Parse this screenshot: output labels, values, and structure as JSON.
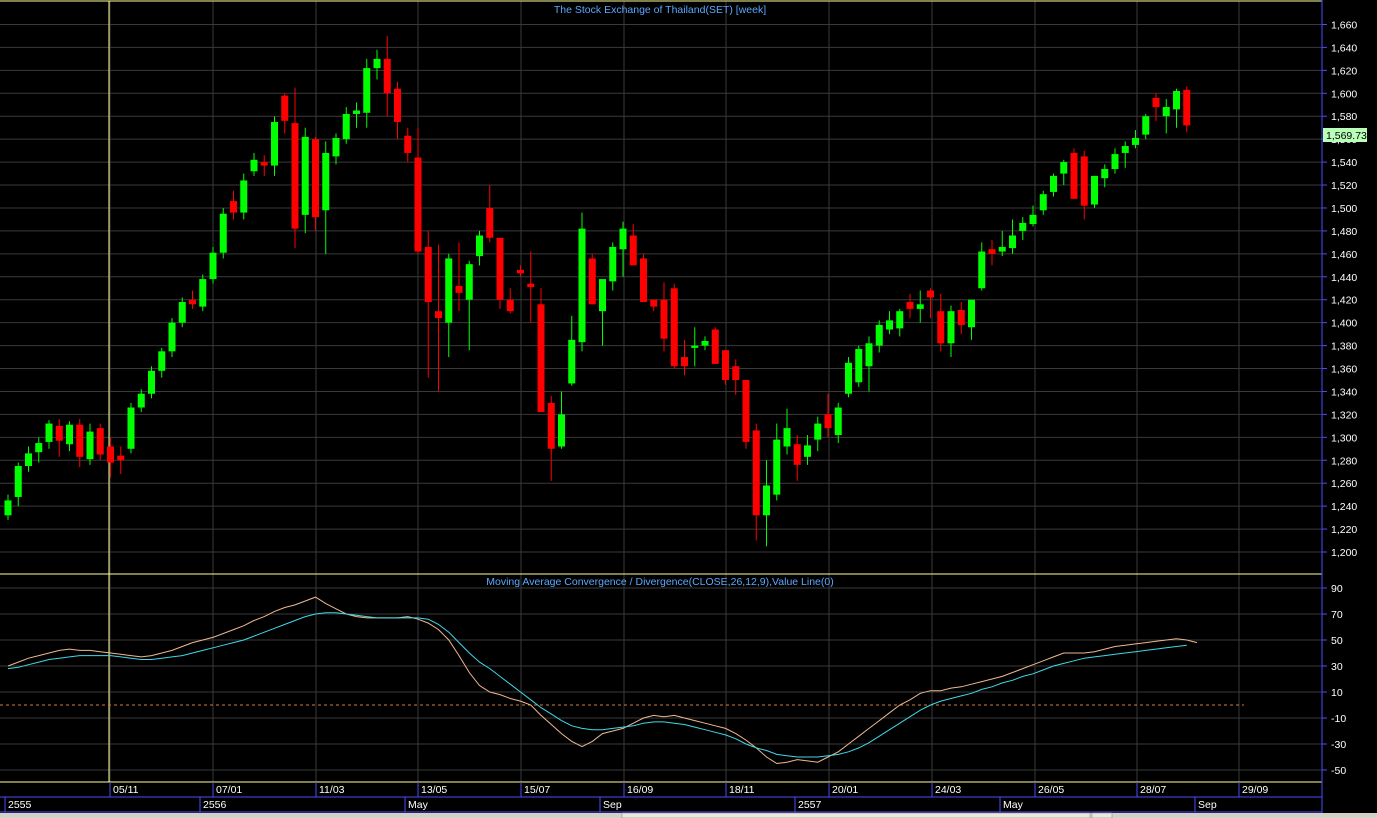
{
  "colors": {
    "background": "#000000",
    "grid": "#3a3a3a",
    "frame": "#ffff9a",
    "axis_frame": "#4b4bff",
    "title": "#5aa8ff",
    "up": "#00ff00",
    "down": "#ff0000",
    "macd_line": "#f0b890",
    "signal_line": "#40d8e8",
    "zero_line": "#d08040",
    "price_tag": "#b8ffb8"
  },
  "price_panel": {
    "title": "The Stock Exchange of Thailand(SET) [week]",
    "last_price_label": "1,569.73",
    "y_ticks": [
      "1,200",
      "1,220",
      "1,240",
      "1,260",
      "1,280",
      "1,300",
      "1,320",
      "1,340",
      "1,360",
      "1,380",
      "1,400",
      "1,420",
      "1,440",
      "1,460",
      "1,480",
      "1,500",
      "1,520",
      "1,540",
      "1,560",
      "1,580",
      "1,600",
      "1,620",
      "1,640",
      "1,660"
    ]
  },
  "macd_panel": {
    "title": "Moving Average Convergence / Divergence(CLOSE,26,12,9),Value Line(0)",
    "y_ticks": [
      "-50",
      "-30",
      "-10",
      "10",
      "30",
      "50",
      "70",
      "90"
    ]
  },
  "date_axis": {
    "upper": [
      "05/11",
      "07/01",
      "11/03",
      "13/05",
      "15/07",
      "16/09",
      "18/11",
      "20/01",
      "24/03",
      "26/05",
      "28/07",
      "29/09"
    ],
    "lower": [
      "2555",
      "2556",
      "May",
      "Sep",
      "2557",
      "May",
      "Sep"
    ]
  },
  "chart_data": [
    {
      "type": "candlestick",
      "title": "The Stock Exchange of Thailand(SET) [week]",
      "ylim": [
        1200,
        1660
      ],
      "candles": [
        [
          1232,
          1250,
          1228,
          1245
        ],
        [
          1248,
          1278,
          1240,
          1275
        ],
        [
          1275,
          1292,
          1270,
          1286
        ],
        [
          1287,
          1300,
          1278,
          1295
        ],
        [
          1296,
          1315,
          1290,
          1312
        ],
        [
          1310,
          1316,
          1283,
          1297
        ],
        [
          1294,
          1314,
          1288,
          1311
        ],
        [
          1311,
          1316,
          1274,
          1283
        ],
        [
          1281,
          1312,
          1276,
          1305
        ],
        [
          1308,
          1312,
          1280,
          1285
        ],
        [
          1292,
          1300,
          1265,
          1278
        ],
        [
          1284,
          1292,
          1268,
          1280
        ],
        [
          1290,
          1330,
          1286,
          1326
        ],
        [
          1326,
          1342,
          1322,
          1338
        ],
        [
          1338,
          1362,
          1334,
          1358
        ],
        [
          1358,
          1378,
          1352,
          1375
        ],
        [
          1375,
          1404,
          1370,
          1400
        ],
        [
          1400,
          1422,
          1396,
          1418
        ],
        [
          1420,
          1428,
          1412,
          1416
        ],
        [
          1414,
          1442,
          1410,
          1438
        ],
        [
          1438,
          1466,
          1434,
          1461
        ],
        [
          1461,
          1500,
          1456,
          1495
        ],
        [
          1506,
          1515,
          1490,
          1496
        ],
        [
          1496,
          1530,
          1490,
          1524
        ],
        [
          1532,
          1548,
          1528,
          1542
        ],
        [
          1540,
          1546,
          1528,
          1537
        ],
        [
          1537,
          1580,
          1528,
          1575
        ],
        [
          1598,
          1600,
          1565,
          1576
        ],
        [
          1574,
          1605,
          1465,
          1482
        ],
        [
          1494,
          1570,
          1478,
          1562
        ],
        [
          1560,
          1562,
          1480,
          1492
        ],
        [
          1498,
          1558,
          1460,
          1548
        ],
        [
          1545,
          1565,
          1538,
          1561
        ],
        [
          1560,
          1588,
          1556,
          1582
        ],
        [
          1582,
          1592,
          1570,
          1585
        ],
        [
          1583,
          1630,
          1570,
          1622
        ],
        [
          1622,
          1638,
          1612,
          1630
        ],
        [
          1630,
          1650,
          1580,
          1600
        ],
        [
          1604,
          1610,
          1560,
          1575
        ],
        [
          1563,
          1570,
          1540,
          1548
        ],
        [
          1544,
          1570,
          1460,
          1462
        ],
        [
          1466,
          1480,
          1352,
          1418
        ],
        [
          1410,
          1468,
          1340,
          1404
        ],
        [
          1400,
          1460,
          1370,
          1456
        ],
        [
          1432,
          1470,
          1410,
          1426
        ],
        [
          1420,
          1454,
          1376,
          1451
        ],
        [
          1458,
          1480,
          1450,
          1476
        ],
        [
          1500,
          1520,
          1470,
          1474
        ],
        [
          1474,
          1462,
          1412,
          1420
        ],
        [
          1420,
          1430,
          1408,
          1410
        ],
        [
          1446,
          1450,
          1440,
          1443
        ],
        [
          1434,
          1462,
          1400,
          1431
        ],
        [
          1416,
          1430,
          1330,
          1322
        ],
        [
          1330,
          1336,
          1262,
          1290
        ],
        [
          1292,
          1340,
          1290,
          1320
        ],
        [
          1347,
          1406,
          1345,
          1385
        ],
        [
          1383,
          1496,
          1375,
          1482
        ],
        [
          1456,
          1460,
          1416,
          1416
        ],
        [
          1410,
          1436,
          1380,
          1438
        ],
        [
          1436,
          1470,
          1428,
          1466
        ],
        [
          1464,
          1488,
          1440,
          1482
        ],
        [
          1476,
          1486,
          1450,
          1450
        ],
        [
          1456,
          1460,
          1420,
          1418
        ],
        [
          1420,
          1420,
          1410,
          1414
        ],
        [
          1420,
          1435,
          1375,
          1386
        ],
        [
          1430,
          1434,
          1360,
          1362
        ],
        [
          1370,
          1385,
          1354,
          1362
        ],
        [
          1378,
          1396,
          1362,
          1380
        ],
        [
          1380,
          1388,
          1376,
          1384
        ],
        [
          1394,
          1396,
          1364,
          1364
        ],
        [
          1376,
          1375,
          1346,
          1350
        ],
        [
          1362,
          1368,
          1337,
          1350
        ],
        [
          1350,
          1346,
          1290,
          1296
        ],
        [
          1306,
          1312,
          1210,
          1232
        ],
        [
          1232,
          1280,
          1205,
          1258
        ],
        [
          1250,
          1312,
          1245,
          1298
        ],
        [
          1292,
          1325,
          1285,
          1308
        ],
        [
          1294,
          1302,
          1262,
          1276
        ],
        [
          1283,
          1302,
          1276,
          1293
        ],
        [
          1298,
          1318,
          1288,
          1312
        ],
        [
          1320,
          1338,
          1300,
          1308
        ],
        [
          1302,
          1330,
          1295,
          1326
        ],
        [
          1338,
          1370,
          1335,
          1365
        ],
        [
          1348,
          1380,
          1344,
          1377
        ],
        [
          1362,
          1388,
          1340,
          1382
        ],
        [
          1380,
          1402,
          1374,
          1398
        ],
        [
          1394,
          1410,
          1390,
          1402
        ],
        [
          1395,
          1412,
          1388,
          1410
        ],
        [
          1418,
          1425,
          1404,
          1412
        ],
        [
          1412,
          1428,
          1400,
          1416
        ],
        [
          1428,
          1430,
          1404,
          1422
        ],
        [
          1410,
          1425,
          1375,
          1382
        ],
        [
          1382,
          1415,
          1370,
          1410
        ],
        [
          1411,
          1418,
          1390,
          1398
        ],
        [
          1396,
          1420,
          1385,
          1420
        ],
        [
          1430,
          1470,
          1428,
          1462
        ],
        [
          1464,
          1472,
          1450,
          1460
        ],
        [
          1462,
          1480,
          1458,
          1466
        ],
        [
          1465,
          1490,
          1460,
          1476
        ],
        [
          1480,
          1492,
          1472,
          1487
        ],
        [
          1486,
          1502,
          1484,
          1494
        ],
        [
          1498,
          1515,
          1494,
          1512
        ],
        [
          1514,
          1530,
          1510,
          1528
        ],
        [
          1530,
          1542,
          1520,
          1540
        ],
        [
          1548,
          1552,
          1510,
          1508
        ],
        [
          1545,
          1550,
          1490,
          1502
        ],
        [
          1503,
          1525,
          1500,
          1528
        ],
        [
          1526,
          1538,
          1518,
          1534
        ],
        [
          1534,
          1552,
          1530,
          1547
        ],
        [
          1548,
          1558,
          1535,
          1554
        ],
        [
          1555,
          1568,
          1552,
          1561
        ],
        [
          1564,
          1582,
          1560,
          1580
        ],
        [
          1596,
          1600,
          1576,
          1588
        ],
        [
          1580,
          1595,
          1565,
          1588
        ],
        [
          1586,
          1604,
          1570,
          1602
        ],
        [
          1603,
          1606,
          1566,
          1572
        ]
      ]
    },
    {
      "type": "line",
      "title": "Moving Average Convergence / Divergence(CLOSE,26,12,9),Value Line(0)",
      "ylim": [
        -60,
        100
      ],
      "series": [
        {
          "color": "#f0b890",
          "values": [
            30,
            33,
            36,
            38,
            40,
            42,
            43,
            42,
            42,
            41,
            40,
            39,
            38,
            37,
            38,
            40,
            42,
            45,
            48,
            50,
            52,
            55,
            58,
            61,
            65,
            68,
            72,
            75,
            77,
            80,
            83,
            78,
            74,
            70,
            68,
            67,
            67,
            67,
            67,
            68,
            66,
            63,
            58,
            50,
            38,
            25,
            15,
            10,
            8,
            5,
            3,
            0,
            -8,
            -15,
            -22,
            -28,
            -32,
            -28,
            -22,
            -20,
            -18,
            -14,
            -10,
            -8,
            -9,
            -8,
            -10,
            -12,
            -14,
            -16,
            -18,
            -22,
            -27,
            -33,
            -40,
            -45,
            -44,
            -42,
            -43,
            -44,
            -40,
            -36,
            -30,
            -24,
            -18,
            -12,
            -6,
            0,
            4,
            9,
            11,
            11,
            13,
            14,
            16,
            18,
            20,
            22,
            25,
            28,
            31,
            34,
            37,
            40,
            40,
            40,
            41,
            43,
            45,
            46,
            47,
            48,
            49,
            50,
            51,
            50,
            48
          ]
        },
        {
          "color": "#40d8e8",
          "values": [
            28,
            29,
            31,
            33,
            35,
            36,
            37,
            38,
            38,
            38,
            38,
            37,
            36,
            35,
            35,
            36,
            37,
            38,
            40,
            42,
            44,
            46,
            48,
            50,
            53,
            56,
            59,
            62,
            65,
            68,
            70,
            71,
            71,
            70,
            69,
            68,
            67,
            67,
            67,
            67,
            67,
            66,
            62,
            56,
            48,
            40,
            33,
            28,
            22,
            16,
            10,
            4,
            -2,
            -7,
            -12,
            -16,
            -18,
            -19,
            -19,
            -18,
            -17,
            -16,
            -14,
            -13,
            -13,
            -14,
            -15,
            -17,
            -19,
            -21,
            -23,
            -26,
            -30,
            -33,
            -35,
            -38,
            -39,
            -40,
            -40,
            -40,
            -39,
            -38,
            -36,
            -33,
            -29,
            -24,
            -19,
            -14,
            -9,
            -4,
            0,
            3,
            5,
            7,
            9,
            12,
            14,
            17,
            19,
            22,
            24,
            27,
            30,
            32,
            34,
            36,
            37,
            38,
            39,
            40,
            41,
            42,
            43,
            44,
            45,
            46
          ]
        }
      ]
    }
  ]
}
